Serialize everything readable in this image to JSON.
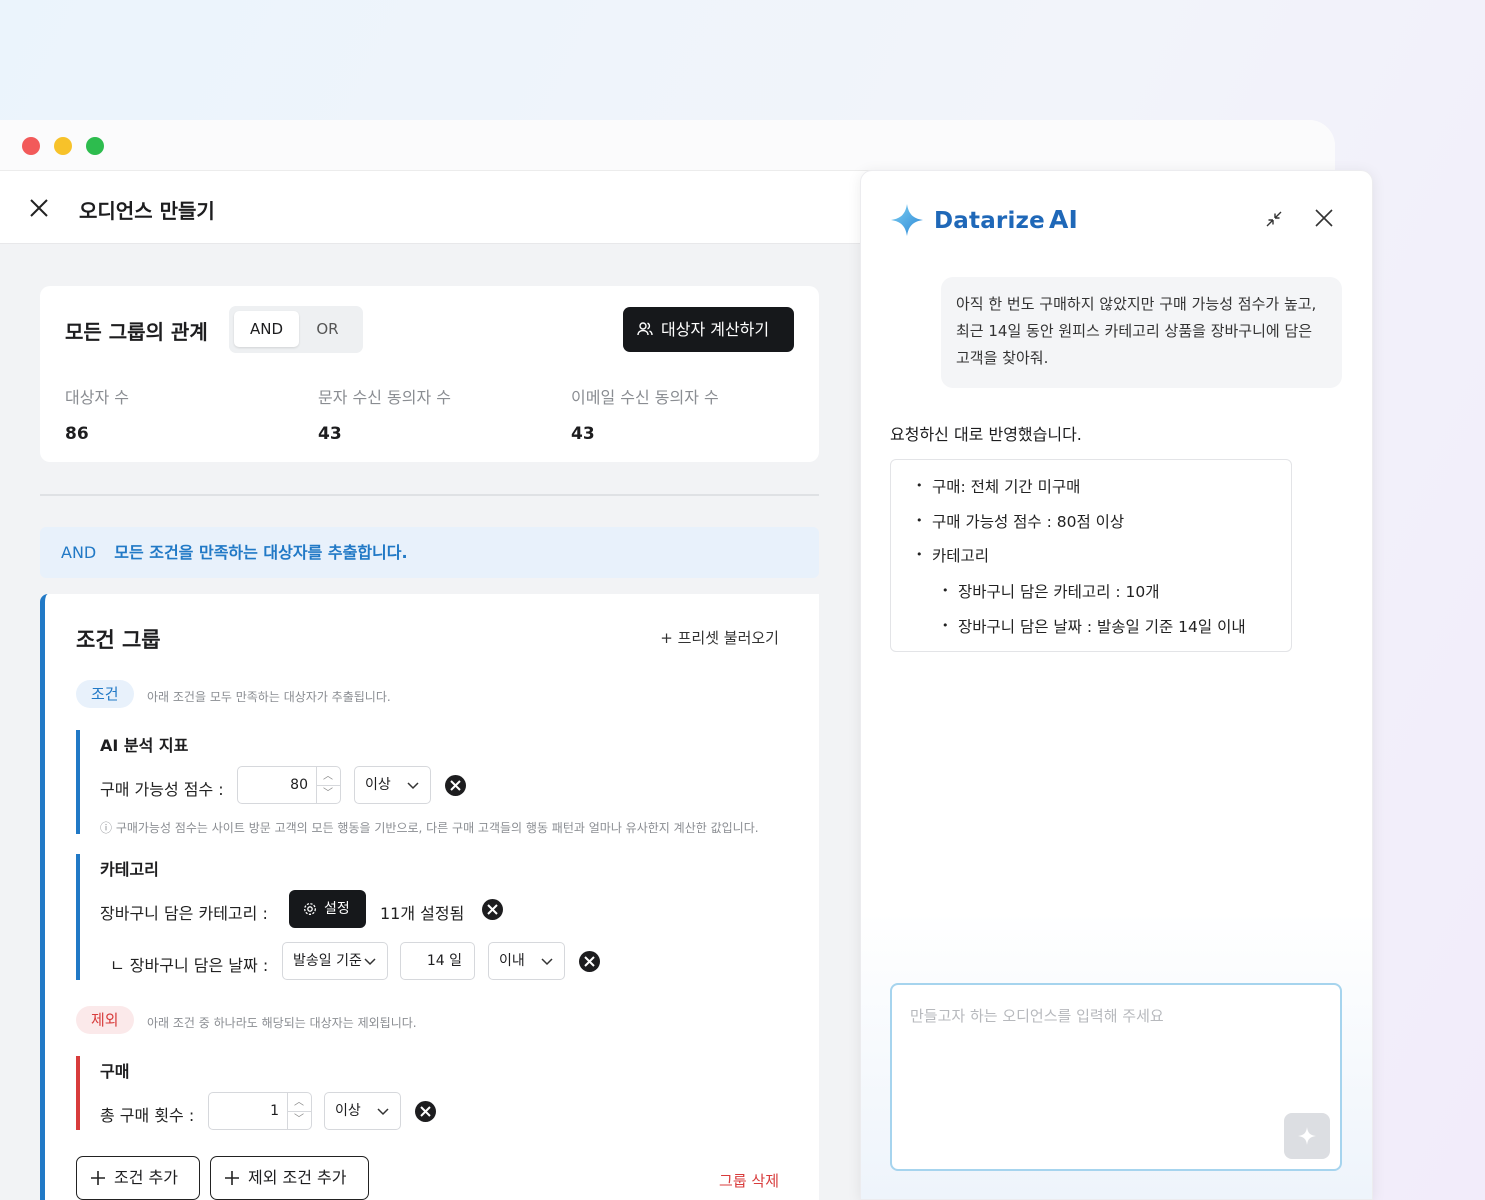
{
  "header": {
    "title": "오디언스 만들기"
  },
  "summary": {
    "title": "모든 그룹의 관계",
    "and_label": "AND",
    "or_label": "OR",
    "calc_button": "대상자 계산하기",
    "stats": [
      {
        "label": "대상자 수",
        "value": "86"
      },
      {
        "label": "문자 수신 동의자 수",
        "value": "43"
      },
      {
        "label": "이메일 수신 동의자 수",
        "value": "43"
      }
    ]
  },
  "banner": {
    "operator": "AND",
    "text": "모든 조건을 만족하는 대상자를 추출합니다."
  },
  "group": {
    "title": "조건 그룹",
    "preset": "+ 프리셋 불러오기",
    "condition_tag": "조건",
    "condition_hint": "아래 조건을 모두 만족하는 대상자가 추출됩니다.",
    "ai_section": "AI 분석 지표",
    "score_label": "구매 가능성 점수 :",
    "score_value": "80",
    "score_op": "이상",
    "score_info": "ⓘ 구매가능성 점수는 사이트 방문 고객의 모든 행동을 기반으로, 다른 구매 고객들의 행동 패턴과 얼마나 유사한지 계산한 값입니다.",
    "category_section": "카테고리",
    "cart_cat_label": "장바구니 담은 카테고리 :",
    "set_button": "설정",
    "set_count": "11개 설정됨",
    "cart_date_label": "ㄴ 장바구니 담은 날짜 :",
    "date_basis": "발송일 기준",
    "date_days": "14 일",
    "date_op": "이내",
    "exclude_tag": "제외",
    "exclude_hint": "아래 조건 중 하나라도 해당되는 대상자는 제외됩니다.",
    "purchase_section": "구매",
    "purchase_label": "총 구매 횟수 :",
    "purchase_value": "1",
    "purchase_op": "이상",
    "add_condition": "조건 추가",
    "add_exclude": "제외 조건 추가",
    "delete_group": "그룹 삭제"
  },
  "ai": {
    "brand": "Datarize",
    "brand_ai": "AI",
    "user_message": "아직 한 번도 구매하지 않았지만 구매 가능성 점수가 높고, 최근 14일 동안 원피스 카테고리 상품을 장바구니에 담은 고객을 찾아줘.",
    "reply": "요청하신 대로 반영했습니다.",
    "items": [
      "구매: 전체 기간 미구매",
      "구매 가능성 점수 : 80점 이상",
      "카테고리"
    ],
    "sub_items": [
      "장바구니 담은 카테고리 : 10개",
      "장바구니 담은 날짜 : 발송일 기준 14일 이내"
    ],
    "placeholder": "만들고자 하는 오디언스를 입력해 주세요"
  },
  "colors": {
    "accent": "#2179c6",
    "danger": "#d83c3c",
    "brand": "#1f68b8",
    "dark_button": "#16181b"
  }
}
